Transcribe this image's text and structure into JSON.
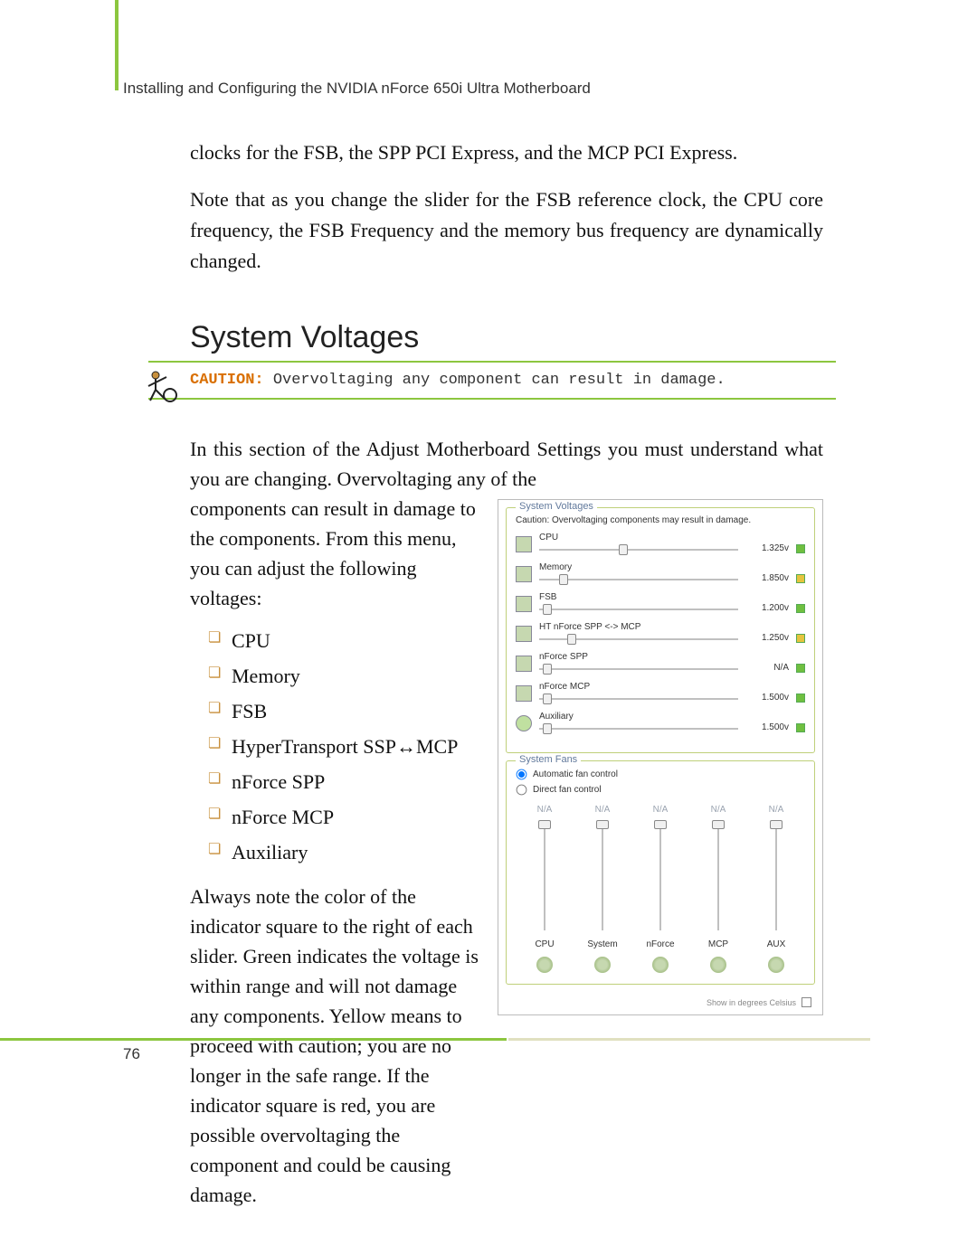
{
  "header": "Installing and Configuring the NVIDIA nForce 650i Ultra Motherboard",
  "intro_p1": "clocks for the FSB, the SPP PCI Express, and the MCP PCI Express.",
  "intro_p2": "Note that as you change the slider for the FSB reference clock, the CPU core frequency, the FSB Frequency and the memory bus frequency are dynamically changed.",
  "section_title": "System Voltages",
  "caution_label": "CAUTION:",
  "caution_text": " Overvoltaging any component can result in damage.",
  "body_intro_full": "In this section of the Adjust Motherboard Settings you must understand what you are changing. Overvoltaging any of the",
  "body_intro_cont": "components can result in damage to the components. From this menu, you can adjust the following voltages:",
  "voltage_items": [
    "CPU",
    "Memory",
    "FSB",
    "HyperTransport SSP↔MCP",
    "nForce SPP",
    "nForce MCP",
    "Auxiliary"
  ],
  "body_after_list": "Always note the color of the indicator square to the right of each slider. Green indicates the voltage is within range and will not damage any components. Yellow means to proceed with caution; you are no longer in the safe range. If the indicator square is red, you are possible overvoltaging the component and could be causing damage.",
  "panel": {
    "legend": "System Voltages",
    "caution_small": "Caution: Overvoltaging components may result in damage.",
    "rows": [
      {
        "label": "CPU",
        "value": "1.325v",
        "indicator": "green",
        "thumb": 40
      },
      {
        "label": "Memory",
        "value": "1.850v",
        "indicator": "yellow",
        "thumb": 10
      },
      {
        "label": "FSB",
        "value": "1.200v",
        "indicator": "green",
        "thumb": 2
      },
      {
        "label": "HT nForce SPP <-> MCP",
        "value": "1.250v",
        "indicator": "yellow",
        "thumb": 14
      },
      {
        "label": "nForce SPP",
        "value": "N/A",
        "indicator": "green",
        "thumb": 2
      },
      {
        "label": "nForce MCP",
        "value": "1.500v",
        "indicator": "green",
        "thumb": 2
      },
      {
        "label": "Auxiliary",
        "value": "1.500v",
        "indicator": "green",
        "thumb": 2
      }
    ]
  },
  "fans": {
    "legend": "System Fans",
    "radio_auto": "Automatic fan control",
    "radio_direct": "Direct fan control",
    "na_label": "N/A",
    "columns": [
      "CPU",
      "System",
      "nForce",
      "MCP",
      "AUX"
    ]
  },
  "celsius_label": "Show in degrees Celsius",
  "page_number": "76"
}
